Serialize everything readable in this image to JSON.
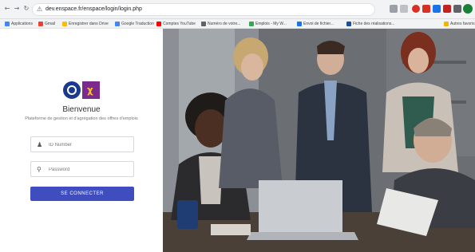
{
  "browser": {
    "url": "dev.enspace.fr/enspace/login/login.php",
    "bookmarks": [
      "Applications",
      "Gmail",
      "Enregistrer dans Drive",
      "Google Traduction",
      "Comptes YouTube",
      "Numéro de votre...",
      "Emplois - My W...",
      "Envoi de fichier...",
      "Fiche des réalisations..."
    ],
    "bookmarks_right": "Autres favoris"
  },
  "login": {
    "title": "Bienvenue",
    "subtitle": "Plateforme de gestion et d'agrégation des offres d'emplois",
    "username_placeholder": "ID Number",
    "password_placeholder": "Password",
    "submit_label": "SE CONNECTER"
  },
  "colors": {
    "accent": "#3f4dbf",
    "logo_primary": "#1a3a8f",
    "logo_secondary": "#7b2a8e"
  }
}
